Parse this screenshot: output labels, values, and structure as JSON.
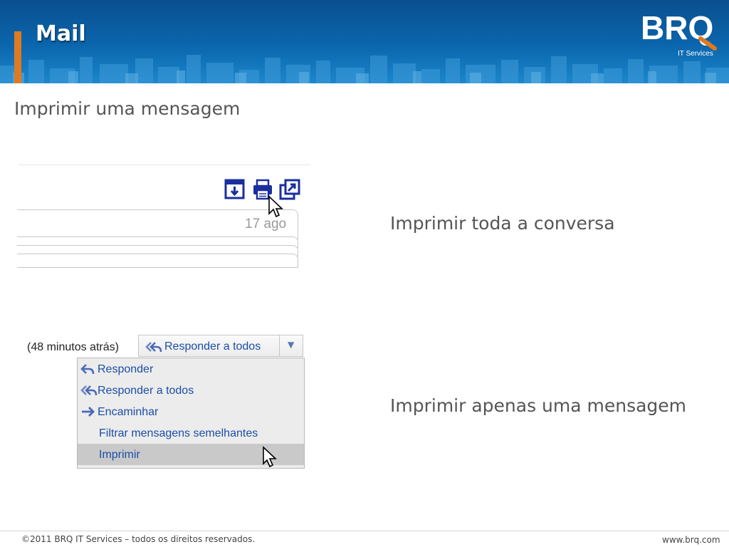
{
  "colors": {
    "header_blue": "#0b66ad",
    "accent_orange": "#e07a1f",
    "link_blue": "#1b4ea8",
    "icon_navy": "#1a2f9e"
  },
  "header": {
    "title": "Mail",
    "logo_text": "BRQ",
    "logo_subtitle": "IT Services"
  },
  "main": {
    "title": "Imprimir uma mensagem",
    "caption_conversation": "Imprimir toda a conversa",
    "caption_single": "Imprimir apenas uma mensagem"
  },
  "conversation_view": {
    "icons": [
      "archive-icon",
      "print-icon",
      "new-window-icon"
    ],
    "date": "17 ago"
  },
  "message_view": {
    "time": "(48 minutos atrás)",
    "reply_all_button": "Responder a todos",
    "menu_items": [
      {
        "label": "Responder",
        "icon": "reply-icon"
      },
      {
        "label": "Responder a todos",
        "icon": "reply-all-icon"
      },
      {
        "label": "Encaminhar",
        "icon": "forward-icon"
      },
      {
        "label": "Filtrar mensagens semelhantes",
        "icon": ""
      },
      {
        "label": "Imprimir",
        "icon": ""
      }
    ]
  },
  "footer": {
    "copyright": "©2011 BRQ IT Services – todos os direitos reservados.",
    "website": "www.brq.com"
  }
}
